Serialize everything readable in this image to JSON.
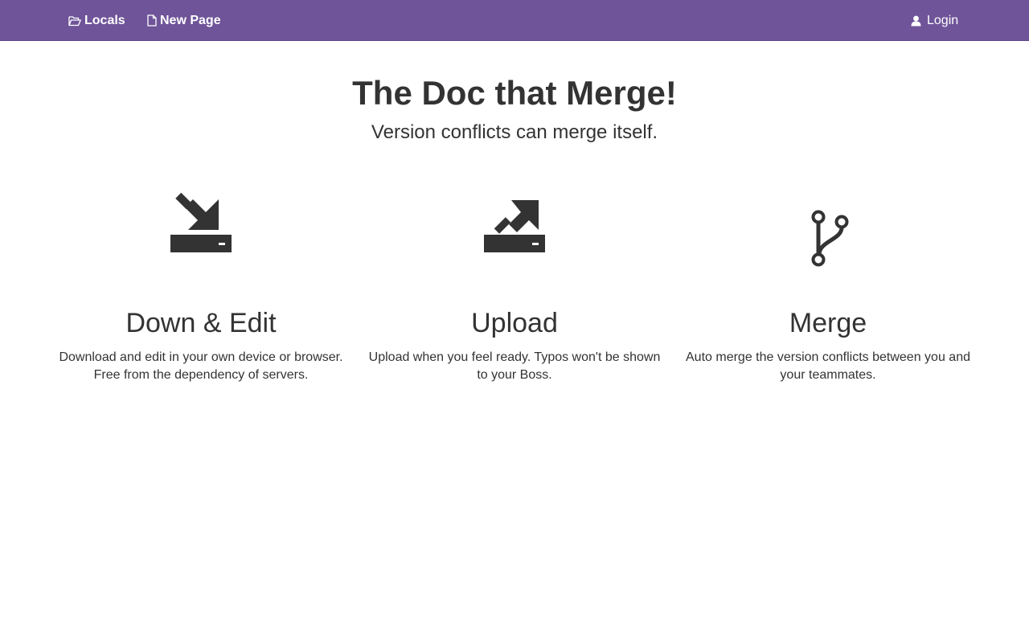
{
  "nav": {
    "locals_label": "Locals",
    "new_page_label": "New Page",
    "login_label": "Login",
    "locals_icon": "folder-open-icon",
    "new_page_icon": "file-icon",
    "login_icon": "user-icon",
    "bar_color": "#6f5499"
  },
  "hero": {
    "title": "The Doc that Merge!",
    "subtitle": "Version conflicts can merge itself."
  },
  "features": [
    {
      "icon": "download-icon",
      "title": "Down & Edit",
      "description": "Download and edit in your own device or browser. Free from the dependency of servers."
    },
    {
      "icon": "upload-icon",
      "title": "Upload",
      "description": "Upload when you feel ready. Typos won't be shown to your Boss."
    },
    {
      "icon": "branch-merge-icon",
      "title": "Merge",
      "description": "Auto merge the version conflicts between you and your teammates."
    }
  ]
}
